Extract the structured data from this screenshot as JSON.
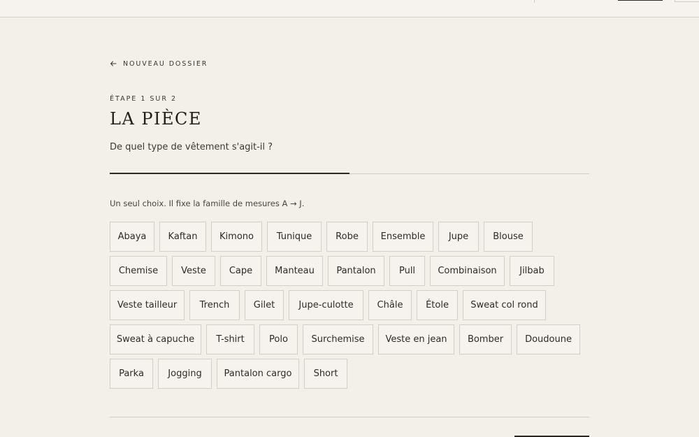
{
  "header": {
    "icons": [
      "topbar-divider",
      "primary-button",
      "secondary-button"
    ]
  },
  "back": {
    "label": "NOUVEAU DOSSIER",
    "icon": "arrow-left-icon"
  },
  "step": {
    "label": "ÉTAPE 1 SUR 2",
    "current": 1,
    "total": 2,
    "progress_fraction": 0.5
  },
  "title": "LA PIÈCE",
  "question": "De quel type de vêtement s'agit-il ?",
  "hint": "Un seul choix. Il fixe la famille de mesures A → J.",
  "options": [
    [
      "Abaya",
      "Kaftan",
      "Kimono",
      "Tunique",
      "Robe",
      "Ensemble",
      "Jupe",
      "Blouse"
    ],
    [
      "Chemise",
      "Veste",
      "Cape",
      "Manteau",
      "Pantalon",
      "Pull",
      "Combinaison",
      "Jilbab"
    ],
    [
      "Veste tailleur",
      "Trench",
      "Gilet",
      "Jupe-culotte",
      "Châle",
      "Étole",
      "Sweat col rond"
    ],
    [
      "Sweat à capuche",
      "T-shirt",
      "Polo",
      "Surchemise",
      "Veste en jean",
      "Bomber",
      "Doudoune"
    ],
    [
      "Parka",
      "Jogging",
      "Pantalon cargo",
      "Short"
    ]
  ],
  "colors": {
    "background": "#f3f0e9",
    "text": "#2b2622",
    "border": "#d3cfc7",
    "accent": "#2f2a26"
  }
}
